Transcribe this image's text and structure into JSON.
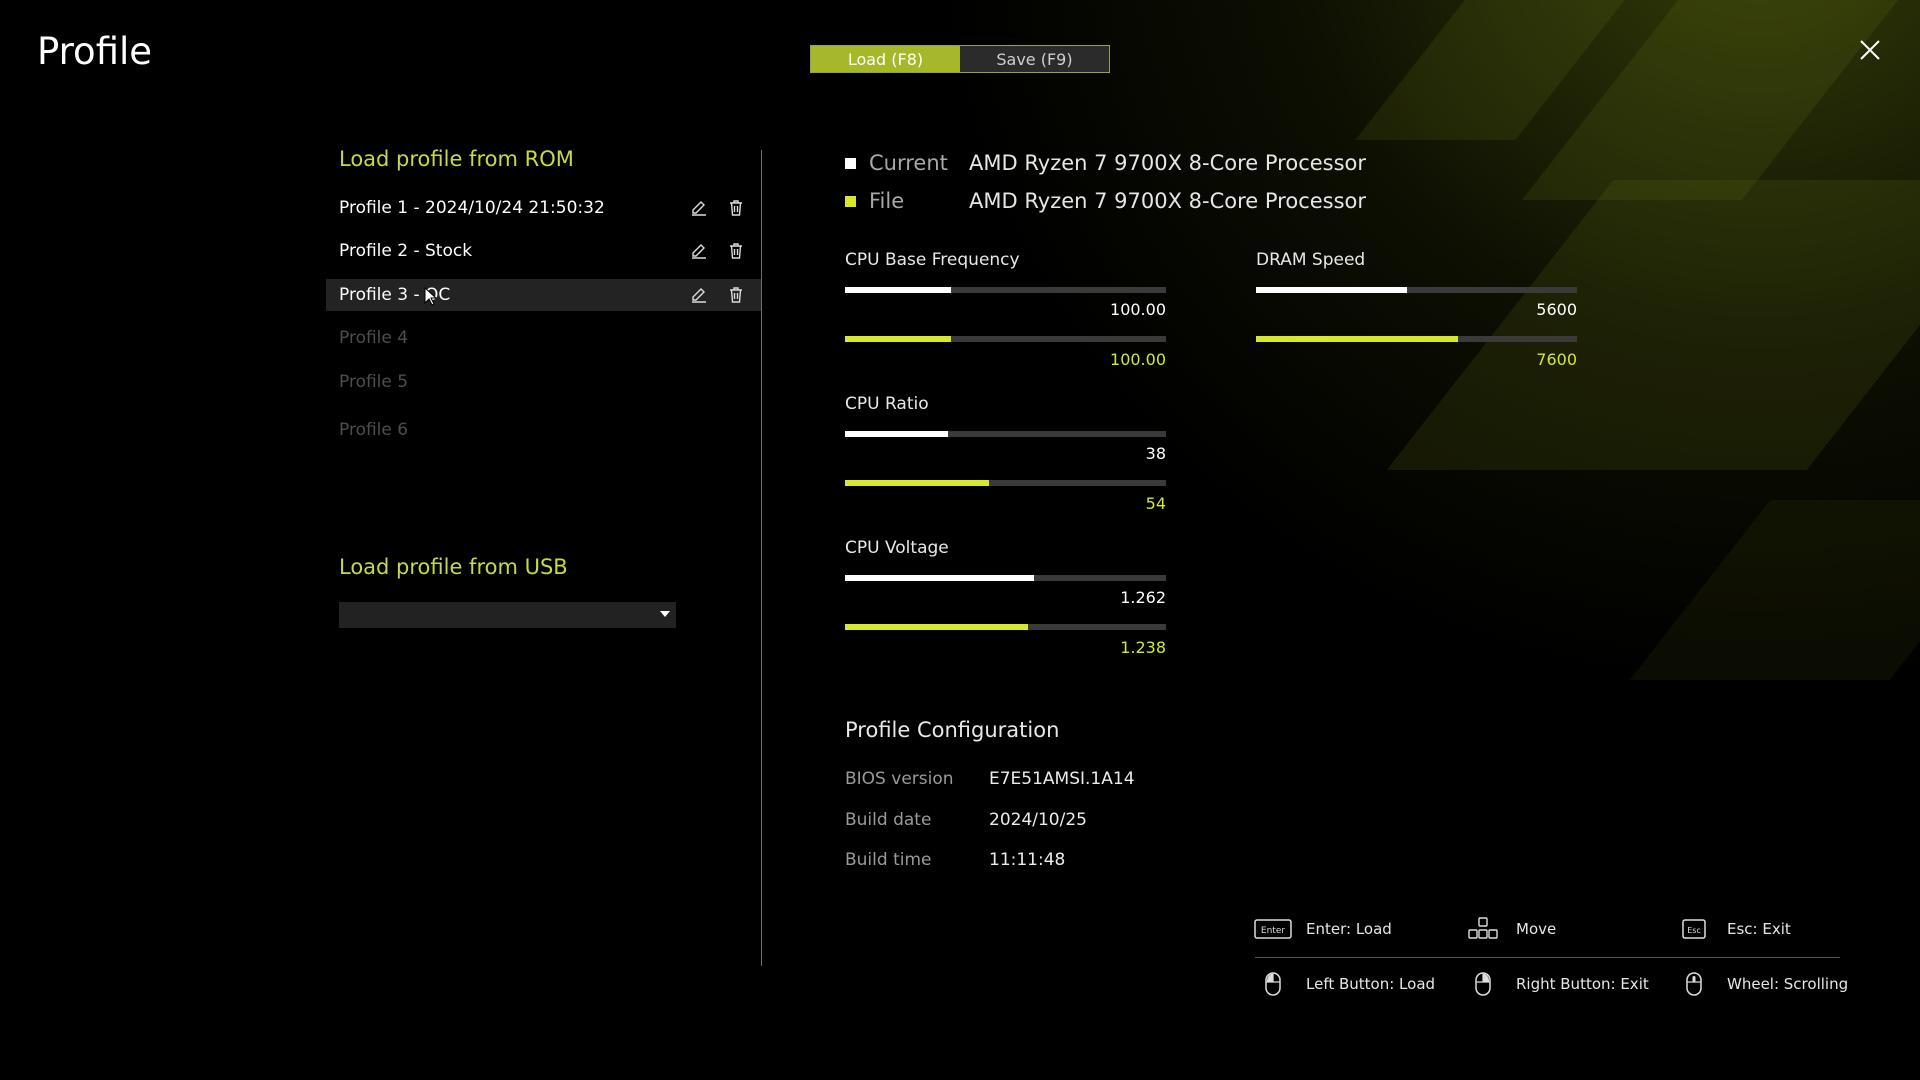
{
  "header": {
    "title": "Profile"
  },
  "tabs": [
    {
      "label": "Load (F8)",
      "active": true
    },
    {
      "label": "Save (F9)",
      "active": false
    }
  ],
  "rom": {
    "heading": "Load profile from ROM",
    "profiles": [
      {
        "name": "Profile 1 - 2024/10/24 21:50:32",
        "filled": true,
        "selected": false
      },
      {
        "name": "Profile 2 - Stock",
        "filled": true,
        "selected": false
      },
      {
        "name": "Profile 3 - OC",
        "filled": true,
        "selected": true
      },
      {
        "name": "Profile 4",
        "filled": false,
        "selected": false
      },
      {
        "name": "Profile 5",
        "filled": false,
        "selected": false
      },
      {
        "name": "Profile 6",
        "filled": false,
        "selected": false
      }
    ]
  },
  "usb": {
    "heading": "Load profile from USB",
    "selected_value": ""
  },
  "compare": {
    "current": {
      "label": "Current",
      "value": "AMD Ryzen 7 9700X 8-Core Processor",
      "color": "#ffffff"
    },
    "file": {
      "label": "File",
      "value": "AMD Ryzen 7 9700X 8-Core Processor",
      "color": "#d6e82a"
    }
  },
  "stats": {
    "cpu_base_freq": {
      "label": "CPU Base Frequency",
      "current": "100.00",
      "file": "100.00",
      "current_fraction": 0.33,
      "file_fraction": 0.33
    },
    "cpu_ratio": {
      "label": "CPU Ratio",
      "current": "38",
      "file": "54",
      "current_fraction": 0.32,
      "file_fraction": 0.45
    },
    "cpu_voltage": {
      "label": "CPU Voltage",
      "current": "1.262",
      "file": "1.238",
      "current_fraction": 0.59,
      "file_fraction": 0.57
    },
    "dram_speed": {
      "label": "DRAM Speed",
      "current": "5600",
      "file": "7600",
      "current_fraction": 0.47,
      "file_fraction": 0.63
    }
  },
  "config": {
    "title": "Profile Configuration",
    "rows": [
      {
        "label": "BIOS version",
        "value": "E7E51AMSI.1A14"
      },
      {
        "label": "Build date",
        "value": "2024/10/25"
      },
      {
        "label": "Build time",
        "value": "11:11:48"
      }
    ]
  },
  "hints": {
    "enter": {
      "icon_text": "Enter",
      "label": "Enter: Load"
    },
    "move": {
      "label": "Move"
    },
    "esc": {
      "icon_text": "Esc",
      "label": "Esc: Exit"
    },
    "left": {
      "label": "Left Button: Load"
    },
    "right": {
      "label": "Right Button: Exit"
    },
    "wheel": {
      "label": "Wheel: Scrolling"
    }
  },
  "colors": {
    "accent": "#c8d84a",
    "bar_yellow": "#d6e82a",
    "tab_active": "#a6b82a"
  }
}
